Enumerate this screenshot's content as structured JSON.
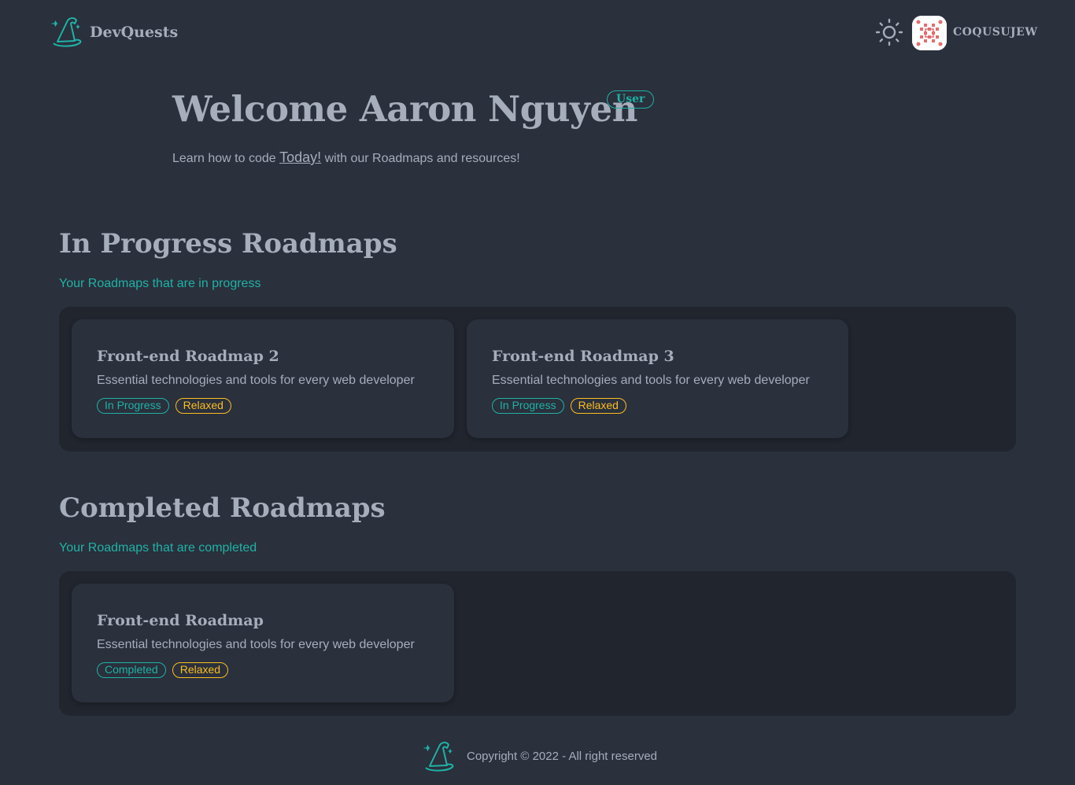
{
  "header": {
    "brand": "DevQuests",
    "username": "COQUSUJEW"
  },
  "hero": {
    "title": "Welcome Aaron Nguyen",
    "role": "User",
    "subtitle_before": "Learn how to code ",
    "subtitle_link": "Today!",
    "subtitle_after": " with our Roadmaps and resources!"
  },
  "in_progress": {
    "title": "In Progress Roadmaps",
    "subtitle": "Your Roadmaps that are in progress",
    "cards": [
      {
        "title": "Front-end Roadmap 2",
        "description": "Essential technologies and tools for every web developer",
        "status": "In Progress",
        "pace": "Relaxed"
      },
      {
        "title": "Front-end Roadmap 3",
        "description": "Essential technologies and tools for every web developer",
        "status": "In Progress",
        "pace": "Relaxed"
      }
    ]
  },
  "completed": {
    "title": "Completed Roadmaps",
    "subtitle": "Your Roadmaps that are completed",
    "cards": [
      {
        "title": "Front-end Roadmap",
        "description": "Essential technologies and tools for every web developer",
        "status": "Completed",
        "pace": "Relaxed"
      }
    ]
  },
  "footer": {
    "copyright": "Copyright © 2022 - All right reserved"
  },
  "colors": {
    "background": "#2a303c",
    "panel": "#20252e",
    "accent": "#1fb2a6",
    "warning": "#fbbd23",
    "text": "#a6adbb"
  },
  "icons": {
    "logo": "wizard-hat-icon",
    "theme": "sun-icon",
    "avatar": "identicon-avatar"
  }
}
